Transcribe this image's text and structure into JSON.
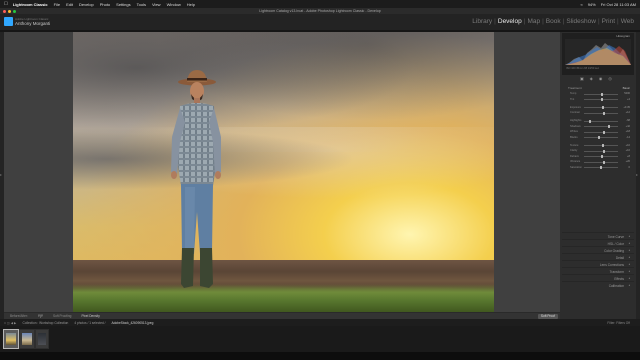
{
  "menubar": {
    "app": "Lightroom Classic",
    "items": [
      "File",
      "Edit",
      "Develop",
      "Photo",
      "Settings",
      "Tools",
      "View",
      "Window",
      "Help"
    ],
    "battery": "94%",
    "datetime": "Fri Oct 28  11:03 AM"
  },
  "window": {
    "title": "Lightroom Catalog v13.lrcat - Adobe Photoshop Lightroom Classic - Develop"
  },
  "identity": {
    "subtitle": "Adobe Lightroom Classic",
    "user": "Anthony Morganti"
  },
  "modules": {
    "items": [
      "Library",
      "Develop",
      "Map",
      "Book",
      "Slideshow",
      "Print",
      "Web"
    ],
    "active": "Develop"
  },
  "toolbar": {
    "before_after_label": "Before/After:",
    "before_after_value": "Y|Y",
    "soft_proof_label": "Soft Proofing",
    "soft_proof_value": "Pixel Density",
    "soft_proof_button": "Soft Proof"
  },
  "right_panel": {
    "histogram_label": "Histogram",
    "histogram_info": "ISO 100   35mm   f/8   1/250 sec",
    "tool_icons": [
      "crop-icon",
      "heal-icon",
      "redeye-icon",
      "mask-icon"
    ],
    "basic_label": "Basic",
    "basic_sub": "Treatment",
    "sliders": [
      {
        "label": "Temp",
        "value": "5400",
        "pos": 0.52
      },
      {
        "label": "Tint",
        "value": "+4",
        "pos": 0.52
      },
      {
        "label": "Exposure",
        "value": "+0.35",
        "pos": 0.57
      },
      {
        "label": "Contrast",
        "value": "+12",
        "pos": 0.58
      },
      {
        "label": "Highlights",
        "value": "-68",
        "pos": 0.18
      },
      {
        "label": "Shadows",
        "value": "+42",
        "pos": 0.73
      },
      {
        "label": "Whites",
        "value": "+18",
        "pos": 0.6
      },
      {
        "label": "Blacks",
        "value": "-14",
        "pos": 0.44
      },
      {
        "label": "Texture",
        "value": "+10",
        "pos": 0.56
      },
      {
        "label": "Clarity",
        "value": "+16",
        "pos": 0.58
      },
      {
        "label": "Dehaze",
        "value": "+8",
        "pos": 0.54
      },
      {
        "label": "Vibrance",
        "value": "+20",
        "pos": 0.6
      },
      {
        "label": "Saturation",
        "value": "0",
        "pos": 0.5
      }
    ],
    "sections": [
      "Tone Curve",
      "HSL / Color",
      "Color Grading",
      "Detail",
      "Lens Corrections",
      "Transform",
      "Effects",
      "Calibration"
    ],
    "previous_button": "Previous",
    "reset_button": "Reset"
  },
  "filmstrip_bar": {
    "path": "Collection : Workshop Collection",
    "count": "4 photos / 1 selected /",
    "filename": "AdobeStock_426090513.jpeg",
    "filter_label": "Filter:",
    "filter_value": "Filters Off"
  },
  "colors": {
    "accent": "#31a8ff",
    "panel": "#2d2d2d",
    "center": "#404040",
    "text_active": "#e8e8e8"
  }
}
